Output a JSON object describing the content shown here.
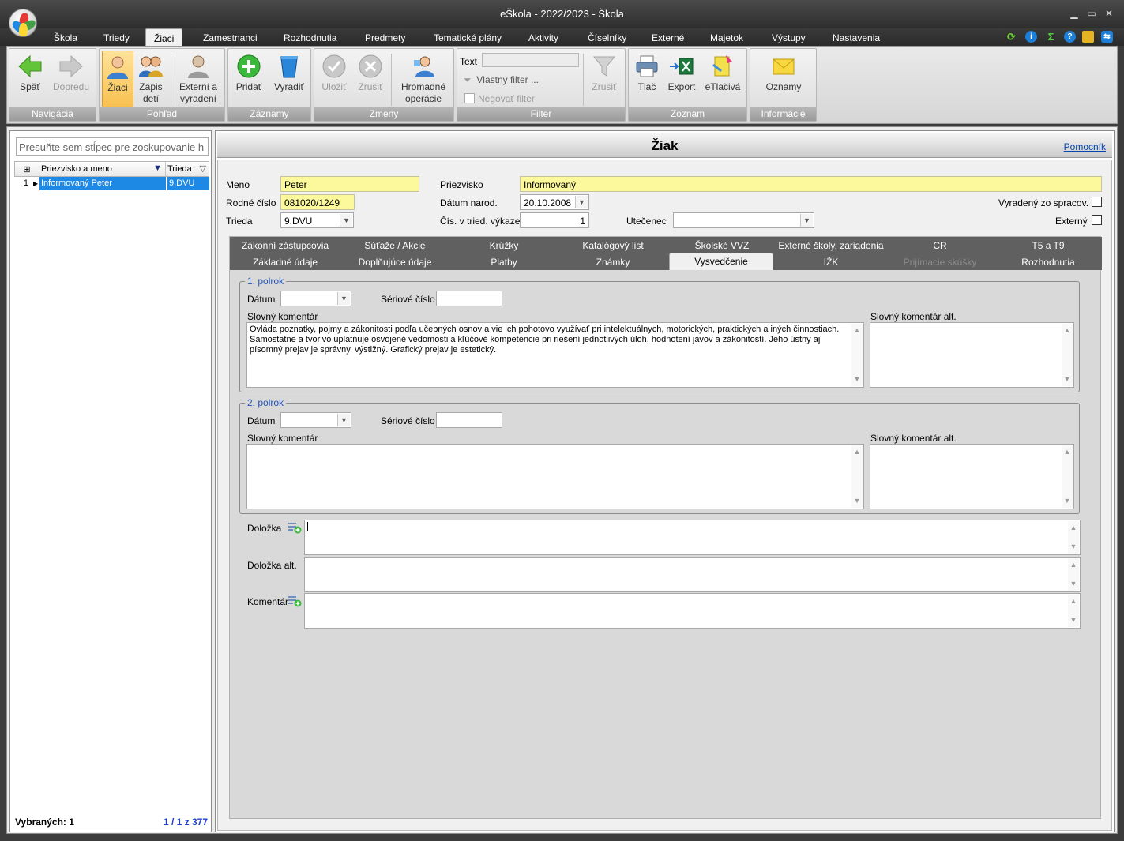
{
  "window": {
    "title": "eŠkola - 2022/2023 - Škola"
  },
  "menu": {
    "items": [
      "Škola",
      "Triedy",
      "Žiaci",
      "Zamestnanci",
      "Rozhodnutia",
      "Predmety",
      "Tematické plány",
      "Aktivity",
      "Číselníky",
      "Externé",
      "Majetok",
      "Výstupy",
      "Nastavenia"
    ],
    "active": "Žiaci"
  },
  "ribbon": {
    "navigacia": {
      "label": "Navigácia",
      "back": "Späť",
      "forward": "Dopredu"
    },
    "pohlad": {
      "label": "Pohľad",
      "ziaci": "Žiaci",
      "zapis1": "Zápis",
      "zapis2": "detí",
      "ext1": "Externí a",
      "ext2": "vyradení"
    },
    "zaznamy": {
      "label": "Záznamy",
      "add": "Pridať",
      "remove": "Vyradiť"
    },
    "zmeny": {
      "label": "Zmeny",
      "save": "Uložiť",
      "cancel": "Zrušiť",
      "bulk1": "Hromadné",
      "bulk2": "operácie"
    },
    "filter": {
      "label": "Filter",
      "text_label": "Text",
      "custom": "Vlastný filter ...",
      "negate": "Negovať filter",
      "cancel": "Zrušiť"
    },
    "zoznam": {
      "label": "Zoznam",
      "print": "Tlač",
      "export": "Export",
      "etlaciva": "eTlačivá"
    },
    "informacie": {
      "label": "Informácie",
      "notices": "Oznamy"
    }
  },
  "left": {
    "group_hint": "Presuňte sem stĺpec pre zoskupovanie h",
    "col_name": "Priezvisko a meno",
    "col_class": "Trieda",
    "rows": [
      {
        "num": "1",
        "name": "Informovaný Peter",
        "class": "9.DVU"
      }
    ],
    "selected_label": "Vybraných:",
    "selected_count": "1",
    "pager": "1 / 1 z 377"
  },
  "page": {
    "title": "Žiak",
    "help": "Pomocník"
  },
  "student": {
    "meno_label": "Meno",
    "meno": "Peter",
    "priezvisko_label": "Priezvisko",
    "priezvisko": "Informovaný",
    "rc_label": "Rodné číslo",
    "rc": "081020/1249",
    "datum_label": "Dátum narod.",
    "datum": "20.10.2008",
    "vyradeny_label": "Vyradený zo spracov.",
    "trieda_label": "Trieda",
    "trieda": "9.DVU",
    "cis_label": "Čís. v tried. výkaze",
    "cis": "1",
    "utecenec_label": "Utečenec",
    "utecenec": "",
    "externy_label": "Externý"
  },
  "tabs": {
    "row1": [
      "Zákonní zástupcovia",
      "Súťaže / Akcie",
      "Krúžky",
      "Katalógový list",
      "Školské VVZ",
      "Externé školy, zariadenia",
      "CR",
      "T5 a T9"
    ],
    "row2": [
      "Základné údaje",
      "Doplňujúce údaje",
      "Platby",
      "Známky",
      "Vysvedčenie",
      "IŽK",
      "Prijímacie skúšky",
      "Rozhodnutia"
    ],
    "active": "Vysvedčenie"
  },
  "polrok1": {
    "legend": "1. polrok",
    "datum_label": "Dátum",
    "datum": "",
    "serial_label": "Sériové číslo",
    "serial": "",
    "comment_label": "Slovný komentár",
    "comment": "Ovláda poznatky, pojmy a zákonitosti podľa učebných osnov a vie ich pohotovo využívať pri intelektuálnych, motorických, praktických a iných činnostiach. Samostatne a tvorivo uplatňuje osvojené vedomosti a kľúčové kompetencie pri riešení jednotlivých úloh, hodnotení javov a zákonitostí. Jeho ústny aj písomný prejav je správny, výstižný. Grafický prejav je estetický.",
    "alt_label": "Slovný komentár alt.",
    "alt": ""
  },
  "polrok2": {
    "legend": "2. polrok",
    "datum_label": "Dátum",
    "datum": "",
    "serial_label": "Sériové číslo",
    "serial": "",
    "comment_label": "Slovný komentár",
    "comment": "",
    "alt_label": "Slovný komentár alt.",
    "alt": ""
  },
  "extra": {
    "dolozka_label": "Doložka",
    "dolozka_alt_label": "Doložka alt.",
    "komentar_label": "Komentár"
  }
}
